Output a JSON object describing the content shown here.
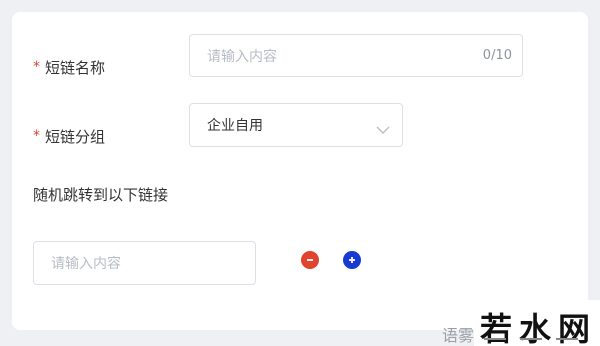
{
  "form": {
    "name_field": {
      "required_mark": "*",
      "label": "短链名称",
      "placeholder": "请输入内容",
      "counter": "0/10"
    },
    "group_field": {
      "required_mark": "*",
      "label": "短链分组",
      "selected": "企业自用"
    },
    "redirect_section": {
      "label": "随机跳转到以下链接",
      "link_placeholder": "请输入内容"
    }
  },
  "watermark": {
    "left_text": "语雾",
    "logo_text": "若水网"
  },
  "colors": {
    "remove_button": "#e0432e",
    "add_button": "#1739d4",
    "required_mark": "#e0432e"
  },
  "icons": {
    "remove": "minus-circle-icon",
    "add": "plus-circle-icon",
    "dropdown": "chevron-down-icon"
  }
}
